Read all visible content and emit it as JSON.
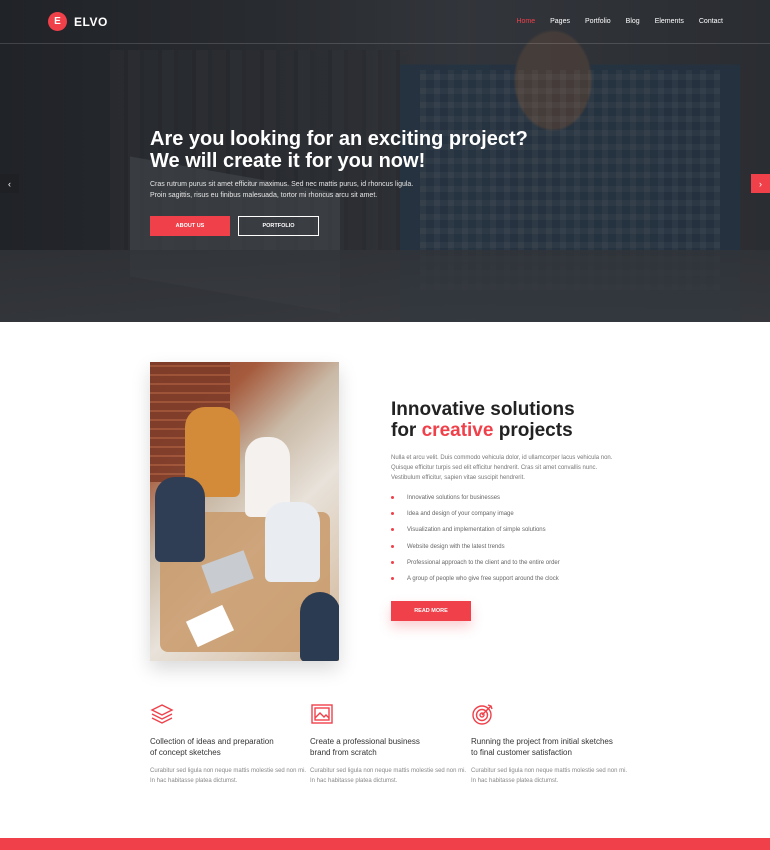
{
  "brand": {
    "mark": "E",
    "name": "ELVO",
    "accent": "#f0404a"
  },
  "nav": {
    "items": [
      "Home",
      "Pages",
      "Portfolio",
      "Blog",
      "Elements",
      "Contact"
    ],
    "active": "Home"
  },
  "hero": {
    "title_line1": "Are you looking for an exciting project?",
    "title_line2": "We will create it for you now!",
    "sub_line1": "Cras rutrum purus sit amet efficitur maximus. Sed nec mattis purus, id rhoncus ligula.",
    "sub_line2": "Proin sagittis, risus eu finibus malesuada, tortor mi rhoncus arcu sit amet.",
    "btn_primary": "ABOUT US",
    "btn_secondary": "PORTFOLIO",
    "arrow_prev": "‹",
    "arrow_next": "›"
  },
  "about": {
    "title_line1": "Innovative solutions",
    "title_pre": "for ",
    "title_highlight": "creative",
    "title_post": " projects",
    "text": "Nulla et arcu velit. Duis commodo vehicula dolor, id ullamcorper lacus vehicula non. Quisque efficitur turpis sed elit efficitur hendrerit. Cras sit amet convallis nunc. Vestibulum efficitur, sapien vitae suscipit hendrerit.",
    "list": [
      "Innovative solutions for businesses",
      "Idea and design of your company image",
      "Visualization and implementation of simple solutions",
      "Website design with the latest trends",
      "Professional approach to the client and to the entire order",
      "A group of people who give free support around the clock"
    ],
    "button": "READ MORE"
  },
  "features": [
    {
      "icon": "layers-icon",
      "title_line1": "Collection of ideas and preparation",
      "title_line2": "of concept sketches",
      "text": "Curabitur sed ligula non neque mattis molestie sed non mi. In hac habitasse platea dictumst."
    },
    {
      "icon": "image-frame-icon",
      "title_line1": "Create a professional business",
      "title_line2": "brand from scratch",
      "text": "Curabitur sed ligula non neque mattis molestie sed non mi. In hac habitasse platea dictumst."
    },
    {
      "icon": "target-icon",
      "title_line1": "Running the project from initial sketches",
      "title_line2": "to final customer satisfaction",
      "text": "Curabitur sed ligula non neque mattis molestie sed non mi. In hac habitasse platea dictumst."
    }
  ]
}
